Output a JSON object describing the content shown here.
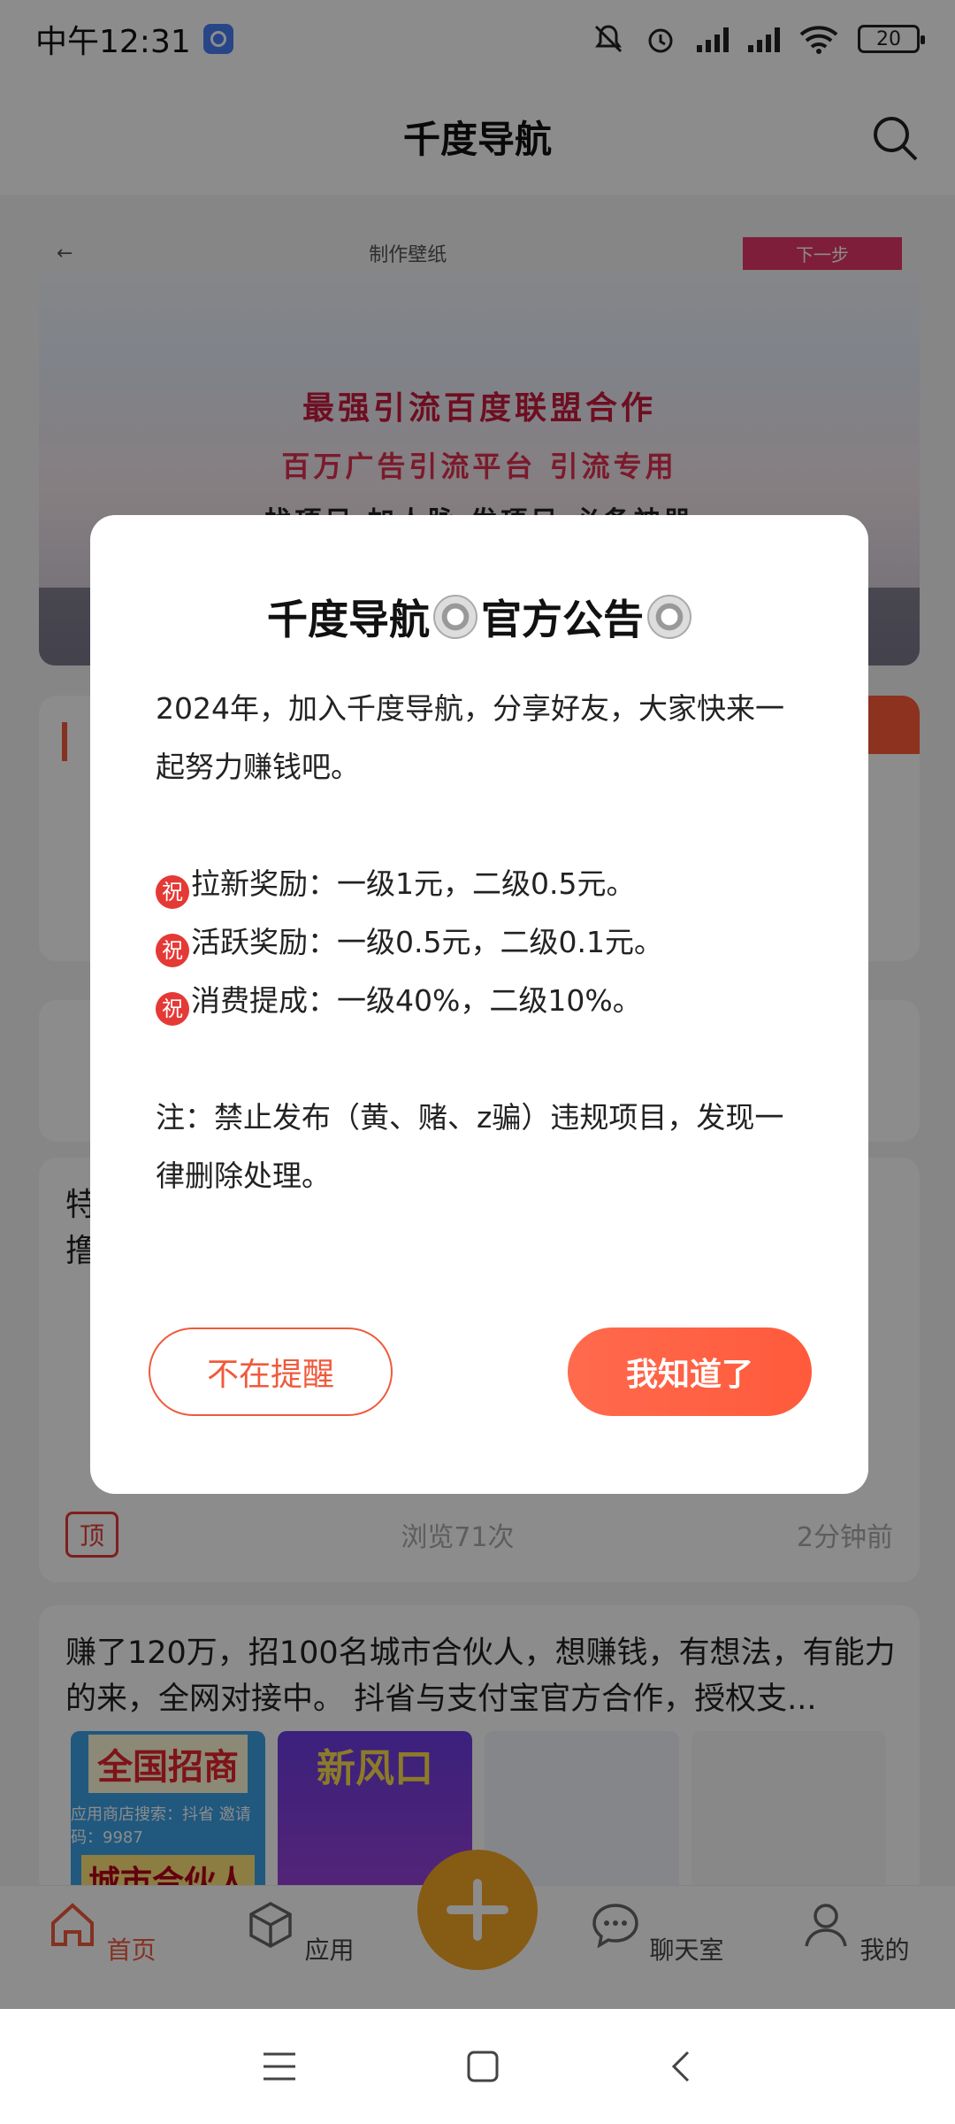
{
  "status_bar": {
    "time": "中午12:31",
    "battery": "20"
  },
  "header": {
    "title": "千度导航"
  },
  "banner": {
    "topbar_title": "制作壁纸",
    "next_label": "下一步",
    "line1": "最强引流百度联盟合作",
    "line2": "百万广告引流平台 引流专用",
    "line3": "找项目 加人脉 发项目 必备神器"
  },
  "feed": {
    "card3": {
      "title_partial": "特",
      "title_partial2": "撸",
      "top_badge": "顶",
      "views": "浏览71次",
      "time": "2分钟前"
    },
    "card4": {
      "text": "赚了120万，招100名城市合伙人，想赚钱，有想法，有能力的来，全网对接中。 抖省与支付宝官方合作，授权支...",
      "thumb1_big": "全国招商",
      "thumb1_mid": "应用商店搜索：抖省 邀请码：9987",
      "thumb1_big2": "城市合伙人",
      "thumb2_big": "新风口"
    }
  },
  "tabs": [
    {
      "label": "首页",
      "icon": "home-icon"
    },
    {
      "label": "应用",
      "icon": "box-icon"
    },
    {
      "label": "聊天室",
      "icon": "chat-icon"
    },
    {
      "label": "我的",
      "icon": "user-icon"
    }
  ],
  "dialog": {
    "title": "千度导航",
    "title2": "官方公告",
    "intro": "2024年，加入千度导航，分享好友，大家快来一起努力赚钱吧。",
    "zhu": "祝",
    "reward1": "拉新奖励：一级1元，二级0.5元。",
    "reward2": "活跃奖励：一级0.5元，二级0.1元。",
    "reward3": "消费提成：一级40%，二级10%。",
    "note": "注：禁止发布（黄、赌、z骗）违规项目，发现一律删除处理。",
    "btn_cancel": "不在提醒",
    "btn_ok": "我知道了"
  },
  "colors": {
    "accent": "#f05a3c",
    "fab": "#f5a623"
  }
}
